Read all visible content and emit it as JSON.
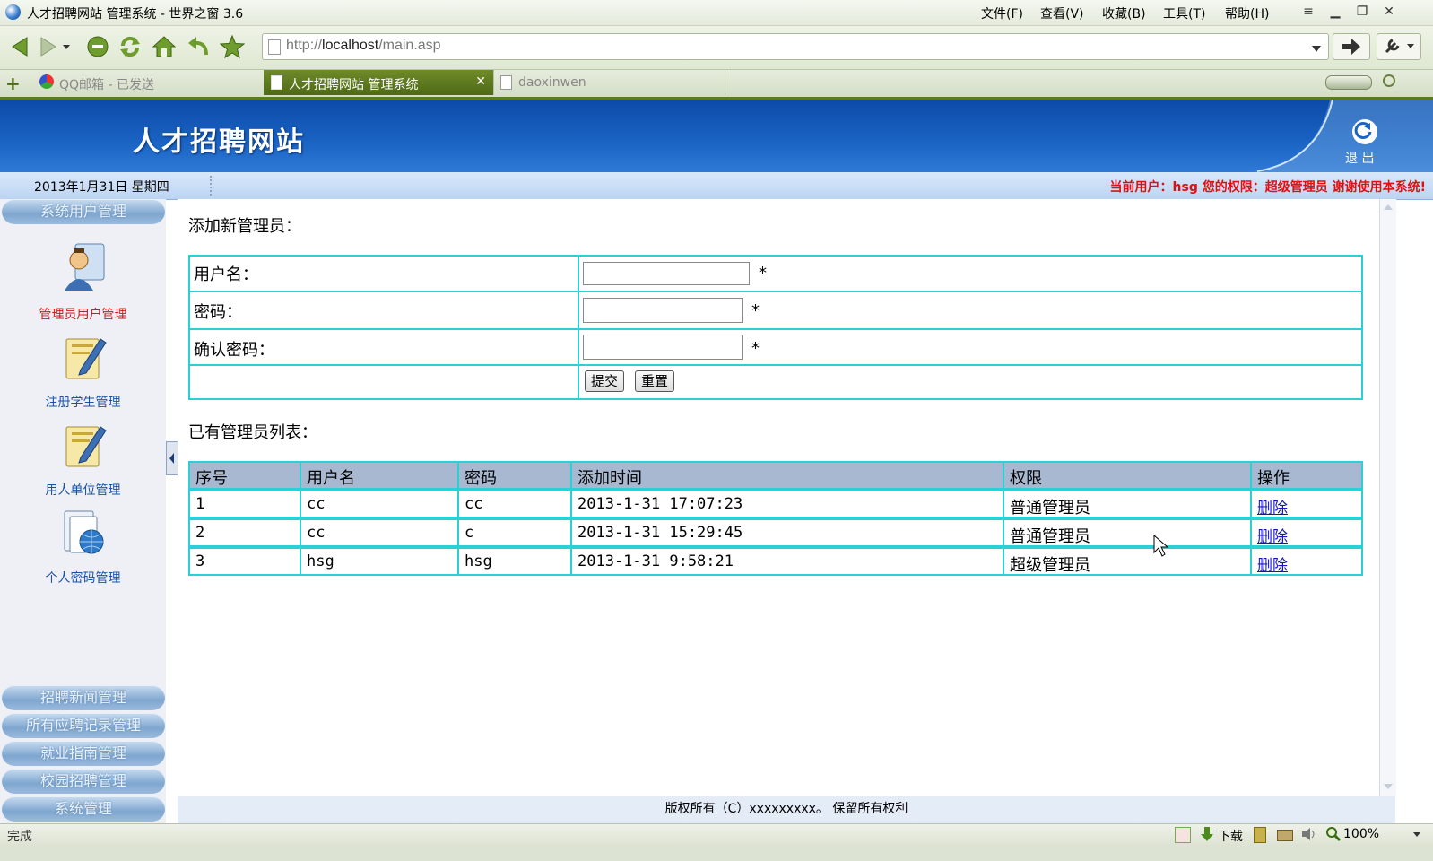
{
  "window": {
    "title": "人才招聘网站 管理系统 - 世界之窗 3.6",
    "menus": [
      "文件(F)",
      "查看(V)",
      "收藏(B)",
      "工具(T)",
      "帮助(H)"
    ]
  },
  "address_bar": {
    "url_prefix": "http://",
    "url_host": "localhost",
    "url_path": "/main.asp"
  },
  "tabs": [
    {
      "label": "QQ邮箱 - 已发送",
      "active": false
    },
    {
      "label": "人才招聘网站 管理系统",
      "active": true
    },
    {
      "label": "daoxinwen",
      "active": false
    }
  ],
  "header": {
    "site_title": "人才招聘网站",
    "logout_label": "退 出"
  },
  "info": {
    "date": "2013年1月31日 星期四",
    "user_line": "当前用户：hsg 您的权限：超级管理员  谢谢使用本系统!"
  },
  "sidebar": {
    "top_group": "系统用户管理",
    "items": [
      {
        "label": "管理员用户管理",
        "active": true
      },
      {
        "label": "注册学生管理",
        "active": false
      },
      {
        "label": "用人单位管理",
        "active": false
      },
      {
        "label": "个人密码管理",
        "active": false
      }
    ],
    "bottom_groups": [
      "招聘新闻管理",
      "所有应聘记录管理",
      "就业指南管理",
      "校园招聘管理",
      "系统管理"
    ]
  },
  "form": {
    "heading": "添加新管理员：",
    "fields": [
      {
        "label": "用户名：",
        "value": "",
        "required_mark": "*"
      },
      {
        "label": "密码：",
        "value": "",
        "required_mark": "*"
      },
      {
        "label": "确认密码：",
        "value": "",
        "required_mark": "*"
      }
    ],
    "submit_label": "提交",
    "reset_label": "重置"
  },
  "admin_list": {
    "heading": "已有管理员列表：",
    "columns": [
      "序号",
      "用户名",
      "密码",
      "添加时间",
      "权限",
      "操作"
    ],
    "rows": [
      {
        "id": "1",
        "username": "cc",
        "password": "cc",
        "added": "2013-1-31 17:07:23",
        "role": "普通管理员",
        "action": "删除"
      },
      {
        "id": "2",
        "username": "cc",
        "password": "c",
        "added": "2013-1-31 15:29:45",
        "role": "普通管理员",
        "action": "删除"
      },
      {
        "id": "3",
        "username": "hsg",
        "password": "hsg",
        "added": "2013-1-31 9:58:21",
        "role": "超级管理员",
        "action": "删除"
      }
    ]
  },
  "footer": {
    "copyright": "版权所有（C）xxxxxxxxx。 保留所有权利"
  },
  "status": {
    "left": "完成",
    "download_label": "下载",
    "zoom": "100%"
  },
  "colors": {
    "banner": "#1a64c4",
    "table_border": "#2ad0d6",
    "table_header": "#a8b8d0",
    "user_line": "#e01010",
    "link": "#1515c8"
  }
}
